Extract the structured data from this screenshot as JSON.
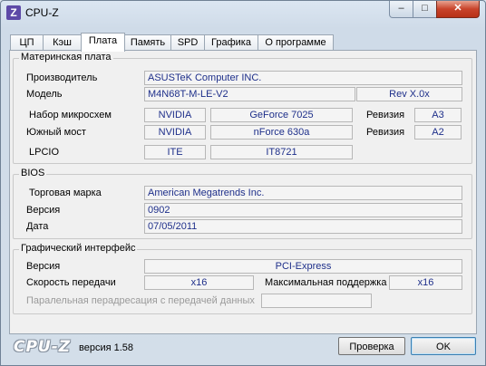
{
  "window": {
    "title": "CPU-Z",
    "icon_letter": "Z",
    "minimize": "–",
    "maximize": "□",
    "close": "✕"
  },
  "tabs": [
    {
      "label": "ЦП"
    },
    {
      "label": "Кэш"
    },
    {
      "label": "Плата"
    },
    {
      "label": "Память"
    },
    {
      "label": "SPD"
    },
    {
      "label": "Графика"
    },
    {
      "label": "О программе"
    }
  ],
  "active_tab": "Плата",
  "motherboard": {
    "title": "Материнская плата",
    "manufacturer_label": "Производитель",
    "manufacturer": "ASUSTeK Computer INC.",
    "model_label": "Модель",
    "model": "M4N68T-M-LE-V2",
    "model_rev": "Rev X.0x",
    "chipset_label": "Набор микросхем",
    "chipset_vendor": "NVIDIA",
    "chipset_name": "GeForce 7025",
    "chipset_rev_label": "Ревизия",
    "chipset_rev": "A3",
    "southbridge_label": "Южный мост",
    "southbridge_vendor": "NVIDIA",
    "southbridge_name": "nForce 630a",
    "southbridge_rev_label": "Ревизия",
    "southbridge_rev": "A2",
    "lpcio_label": "LPCIO",
    "lpcio_vendor": "ITE",
    "lpcio_name": "IT8721"
  },
  "bios": {
    "title": "BIOS",
    "brand_label": "Торговая марка",
    "brand": "American Megatrends Inc.",
    "version_label": "Версия",
    "version": "0902",
    "date_label": "Дата",
    "date": "07/05/2011"
  },
  "graphic_interface": {
    "title": "Графический интерфейс",
    "version_label": "Версия",
    "version": "PCI-Express",
    "link_width_label": "Скорость передачи",
    "link_width": "x16",
    "max_supported_label": "Максимальная поддержка",
    "max_supported": "x16",
    "sideband_label": "Паралельная перадресация с передачей данных",
    "sideband": ""
  },
  "footer": {
    "logo": "CPU-Z",
    "version": "версия 1.58",
    "validate_button": "Проверка",
    "ok_button": "OK"
  }
}
